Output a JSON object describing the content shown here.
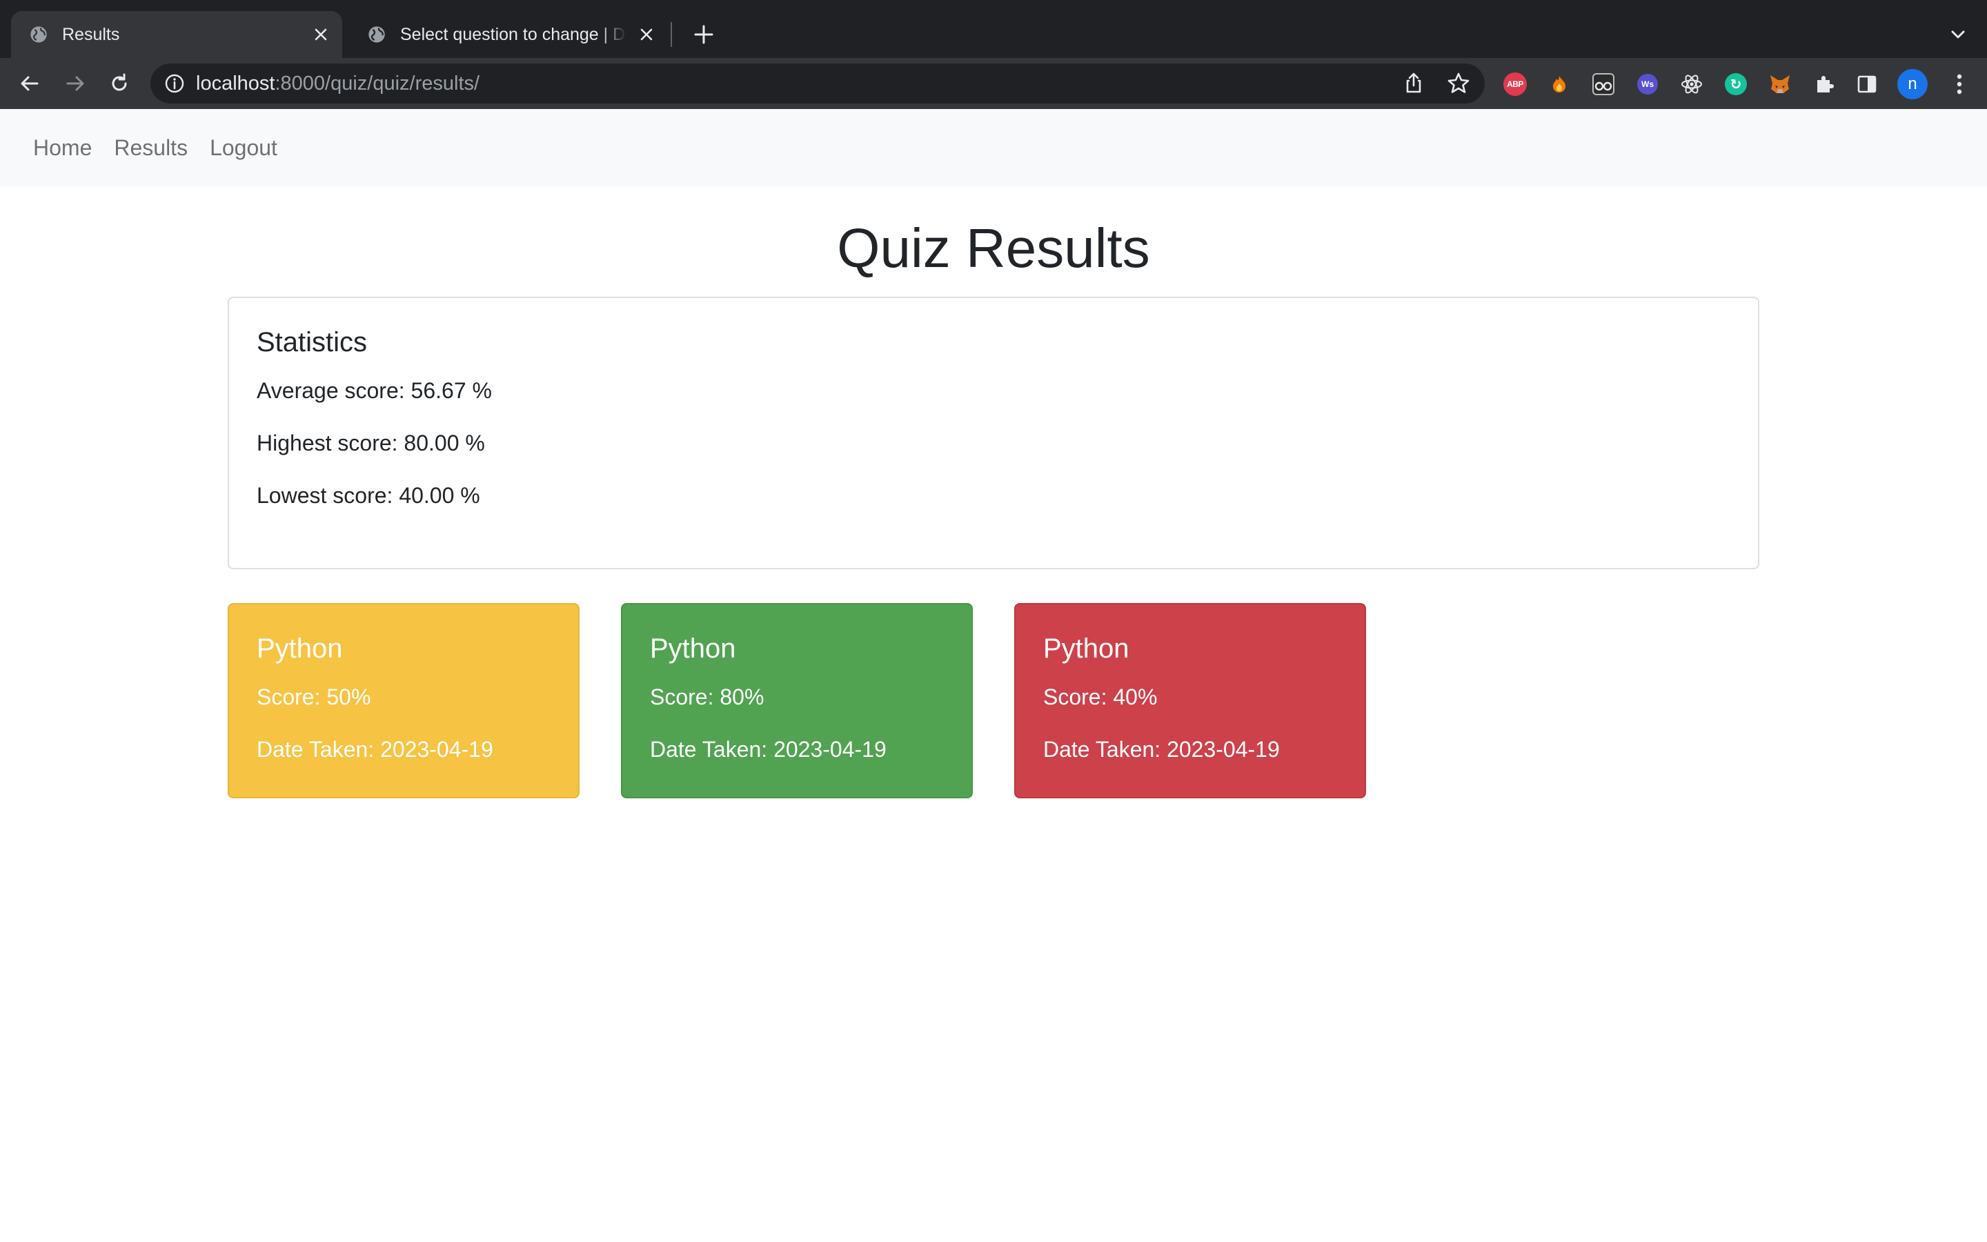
{
  "browser": {
    "tabs": [
      {
        "title": "Results",
        "active": true
      },
      {
        "title": "Select question to change | Django site admin",
        "active": false
      }
    ],
    "address": {
      "host": "localhost",
      "path": ":8000/quiz/quiz/results/"
    },
    "extensions": [
      {
        "name": "adblock-plus-icon",
        "label": "ABP"
      },
      {
        "name": "fire-extension-icon"
      },
      {
        "name": "glasses-extension-icon"
      },
      {
        "name": "websocket-extension-icon",
        "label": "Ws"
      },
      {
        "name": "react-devtools-icon"
      },
      {
        "name": "grammarly-icon"
      },
      {
        "name": "metamask-fox-icon"
      },
      {
        "name": "extensions-puzzle-icon"
      },
      {
        "name": "side-panel-icon"
      }
    ],
    "profile_initial": "n"
  },
  "nav": {
    "home": "Home",
    "results": "Results",
    "logout": "Logout"
  },
  "page": {
    "title": "Quiz Results"
  },
  "statistics": {
    "heading": "Statistics",
    "average": "Average score: 56.67 %",
    "highest": "Highest score: 80.00 %",
    "lowest": "Lowest score: 40.00 %"
  },
  "results": [
    {
      "subject": "Python",
      "score": "Score: 50%",
      "date": "Date Taken: 2023-04-19",
      "color": "#f6c343"
    },
    {
      "subject": "Python",
      "score": "Score: 80%",
      "date": "Date Taken: 2023-04-19",
      "color": "#51a351"
    },
    {
      "subject": "Python",
      "score": "Score: 40%",
      "date": "Date Taken: 2023-04-19",
      "color": "#cd414a"
    }
  ],
  "colors": {
    "chrome_dark": "#202124",
    "chrome_toolbar": "#35363a",
    "navbar_bg": "#f8f9fa",
    "warning": "#f6c343",
    "success": "#51a351",
    "danger": "#cd414a"
  }
}
